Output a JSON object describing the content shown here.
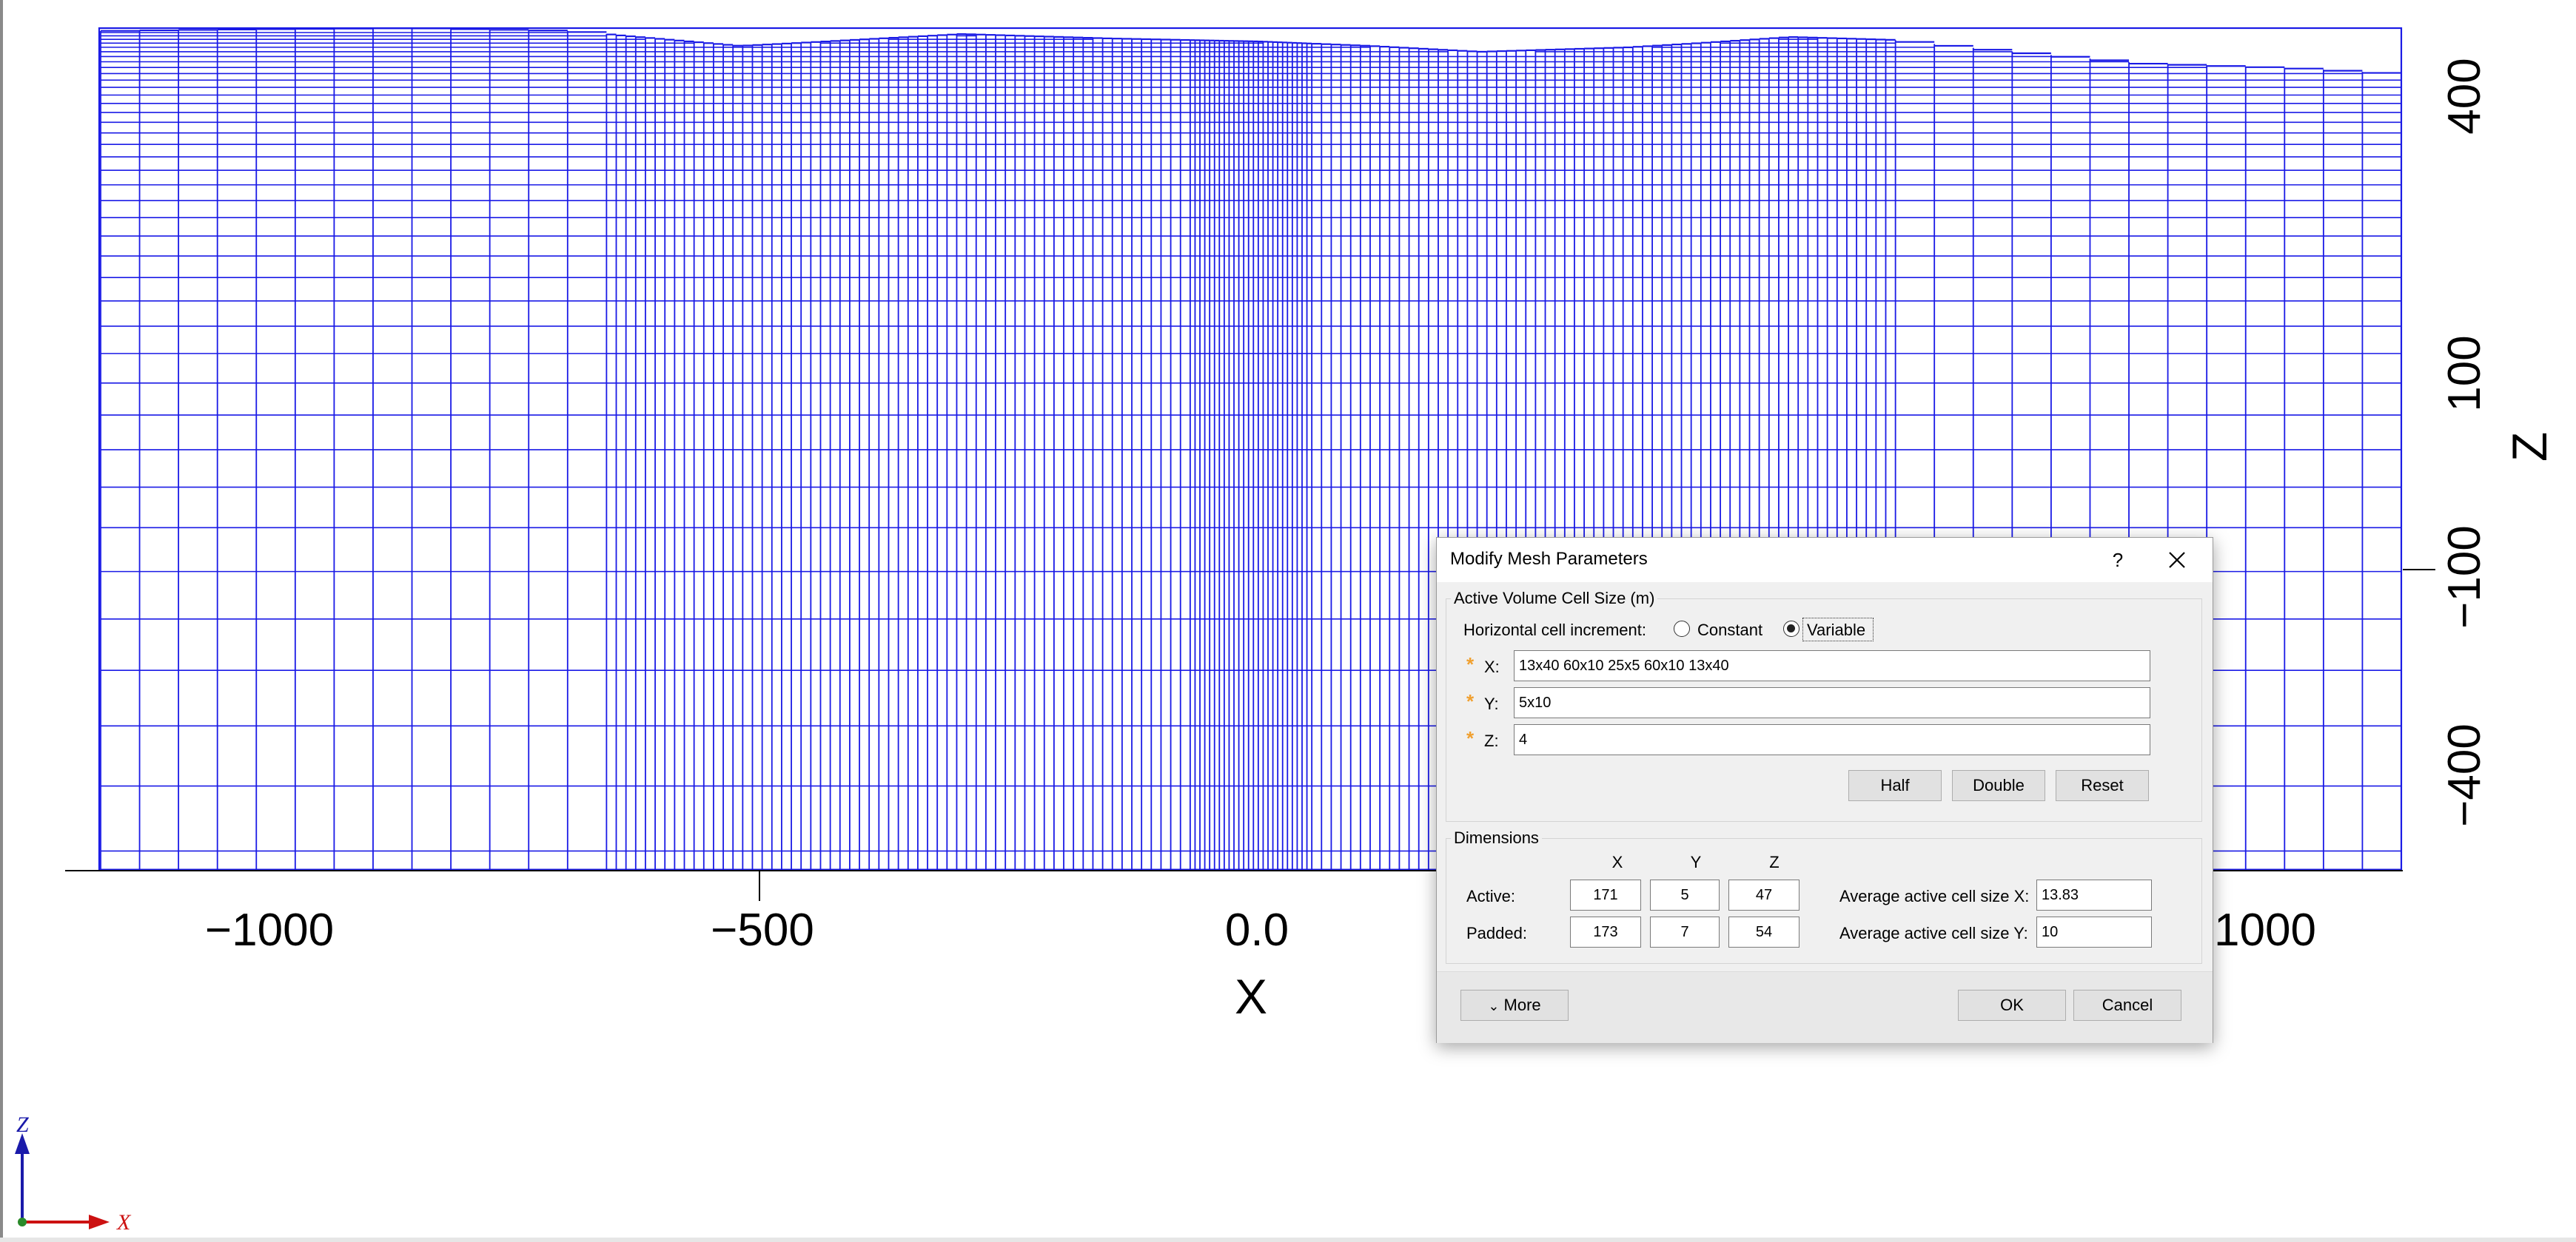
{
  "viewport": {
    "mesh_color": "#1a1ae6",
    "x_axis": {
      "title": "X",
      "tick_labels": [
        "−1000",
        "−500",
        "0.0",
        "1000"
      ]
    },
    "z_axis": {
      "title": "Z",
      "tick_labels": [
        "400",
        "100",
        "−100",
        "−400"
      ]
    },
    "orientation_triad": {
      "z_label": "Z",
      "x_label": "X",
      "z_color": "#1a1aaa",
      "x_color": "#cc1111"
    }
  },
  "dialog": {
    "title": "Modify Mesh Parameters",
    "help_label": "?",
    "active_volume": {
      "group_title": "Active Volume Cell Size (m)",
      "horizontal_increment_label": "Horizontal cell increment:",
      "options": [
        "Constant",
        "Variable"
      ],
      "selected": "Variable",
      "x_label": "X:",
      "y_label": "Y:",
      "z_label": "Z:",
      "x_value": "13x40 60x10 25x5 60x10 13x40",
      "y_value": "5x10",
      "z_value": "4",
      "buttons": {
        "half": "Half",
        "double": "Double",
        "reset": "Reset"
      }
    },
    "dimensions": {
      "group_title": "Dimensions",
      "col_headers": [
        "X",
        "Y",
        "Z"
      ],
      "active_label": "Active:",
      "padded_label": "Padded:",
      "active": [
        "171",
        "5",
        "47"
      ],
      "padded": [
        "173",
        "7",
        "54"
      ],
      "avg_x_label": "Average active cell size X:",
      "avg_y_label": "Average active cell size Y:",
      "avg_x": "13.83",
      "avg_y": "10"
    },
    "more_label": "More",
    "ok_label": "OK",
    "cancel_label": "Cancel"
  }
}
